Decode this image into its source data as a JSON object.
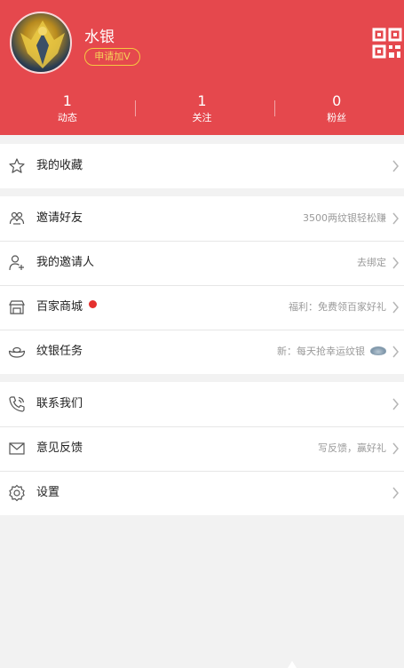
{
  "profile": {
    "username": "水银",
    "apply_v_label": "申请加V"
  },
  "stats": [
    {
      "value": "1",
      "label": "动态"
    },
    {
      "value": "1",
      "label": "关注"
    },
    {
      "value": "0",
      "label": "粉丝"
    }
  ],
  "menu": {
    "favorites": {
      "label": "我的收藏"
    },
    "invite_friends": {
      "label": "邀请好友",
      "hint": "3500两纹银轻松赚"
    },
    "my_inviter": {
      "label": "我的邀请人",
      "hint": "去绑定"
    },
    "mall": {
      "label": "百家商城",
      "hint": "福利：免费领百家好礼"
    },
    "tasks": {
      "label": "纹银任务",
      "hint": "新：每天抢幸运纹银"
    },
    "contact": {
      "label": "联系我们"
    },
    "feedback": {
      "label": "意见反馈",
      "hint": "写反馈，赢好礼"
    },
    "settings": {
      "label": "设置"
    }
  },
  "colors": {
    "header_bg": "#e5484d",
    "badge_gold": "#f5c842",
    "notification_dot": "#e5302e"
  },
  "icons": {
    "qr": "qr-code-icon",
    "favorites": "star-icon",
    "invite": "invite-icon",
    "inviter": "add-user-icon",
    "mall": "store-icon",
    "tasks": "silver-ingot-icon",
    "contact": "phone-icon",
    "feedback": "mail-icon",
    "settings": "gear-icon",
    "chevron": "chevron-right-icon"
  }
}
